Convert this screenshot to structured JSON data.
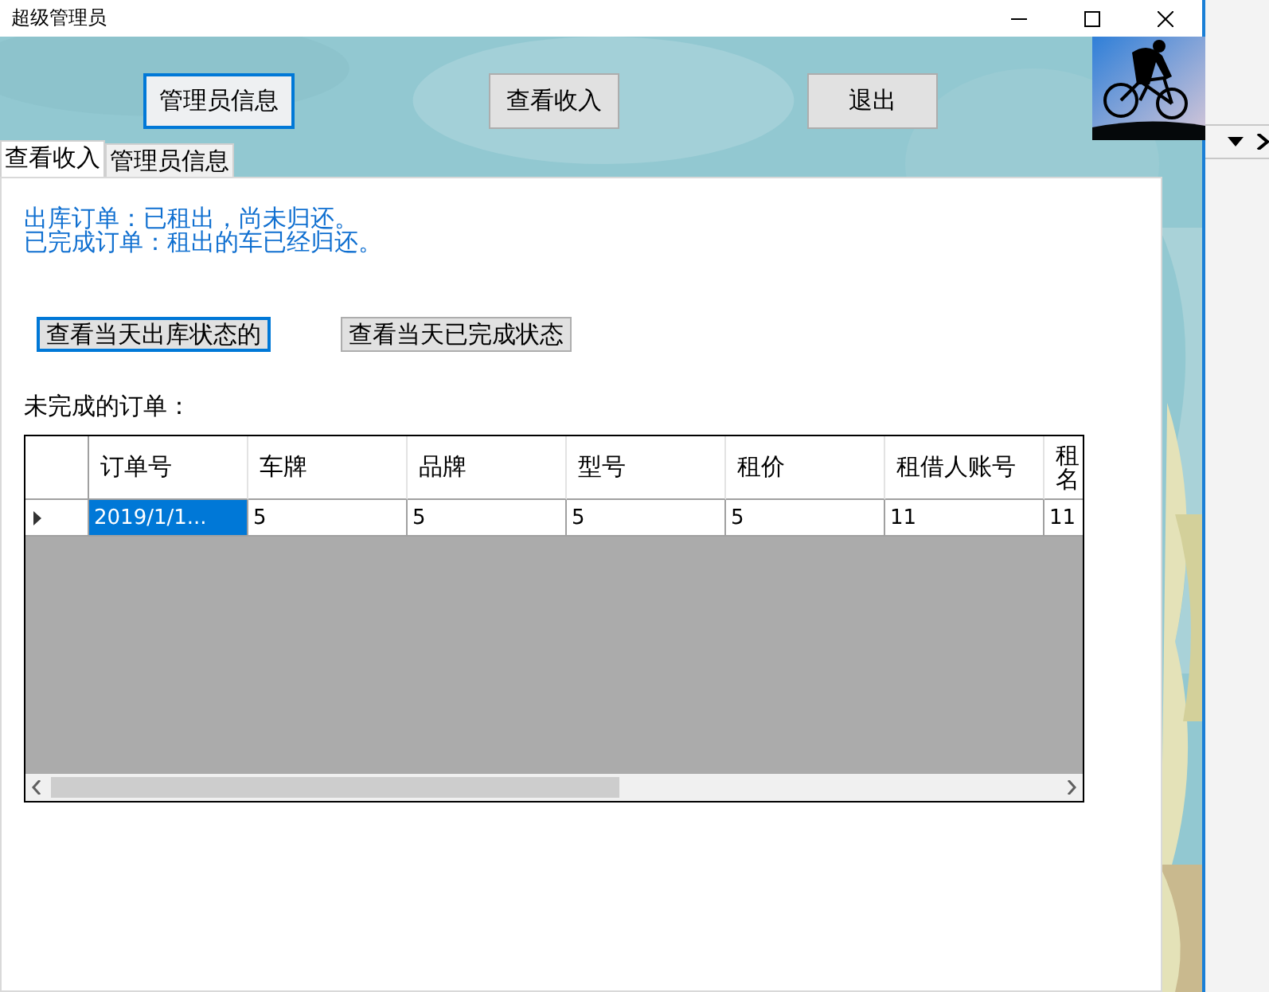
{
  "window": {
    "title": "超级管理员"
  },
  "top_buttons": [
    {
      "label": "管理员信息",
      "focused": true
    },
    {
      "label": "查看收入",
      "focused": false
    },
    {
      "label": "退出",
      "focused": false
    }
  ],
  "tabs": [
    {
      "label": "查看收入",
      "selected": true
    },
    {
      "label": "管理员信息",
      "selected": false
    }
  ],
  "notes": [
    "出库订单：已租出，尚未归还。",
    "已完成订单：租出的车已经归还。"
  ],
  "filter_buttons": [
    {
      "label": "查看当天出库状态的",
      "focused": true
    },
    {
      "label": "查看当天已完成状态",
      "focused": false
    }
  ],
  "table": {
    "caption": "未完成的订单：",
    "columns": [
      "订单号",
      "车牌",
      "品牌",
      "型号",
      "租价",
      "租借人账号",
      "租名"
    ],
    "rows": [
      {
        "current": true,
        "cells": [
          {
            "text": "2019/1/1...",
            "selected": true
          },
          {
            "text": "5",
            "selected": false
          },
          {
            "text": "5",
            "selected": false
          },
          {
            "text": "5",
            "selected": false
          },
          {
            "text": "5",
            "selected": false
          },
          {
            "text": "11",
            "selected": false
          },
          {
            "text": "11",
            "selected": false
          }
        ]
      }
    ]
  }
}
